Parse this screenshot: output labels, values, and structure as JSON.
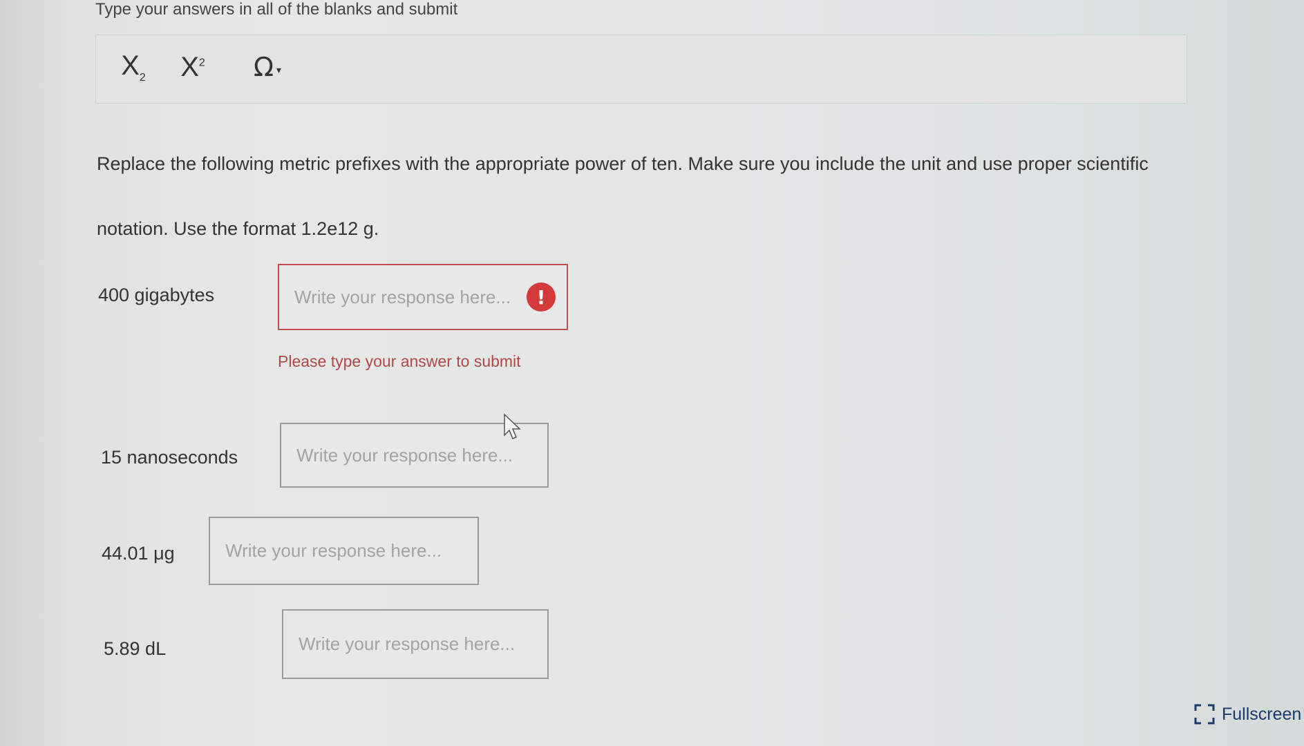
{
  "instruction": "Type your answers in all of the blanks and submit",
  "toolbar": {
    "subscript": "X",
    "subscript_mark": "2",
    "superscript": "X",
    "superscript_mark": "2",
    "special_char": "Ω",
    "special_char_caret": "▾"
  },
  "question": "Replace the following metric prefixes with the appropriate power of ten.  Make sure you include the unit and use proper scientific notation.  Use the format 1.2e12 g.",
  "items": [
    {
      "label": "400 gigabytes",
      "placeholder": "Write your response here...",
      "value": ""
    },
    {
      "label": "15 nanoseconds",
      "placeholder": "Write your response here...",
      "value": ""
    },
    {
      "label": "44.01 μg",
      "placeholder": "Write your response here...",
      "value": ""
    },
    {
      "label": "5.89 dL",
      "placeholder": "Write your response here...",
      "value": ""
    }
  ],
  "error": {
    "icon": "!",
    "message": "Please type your answer to submit"
  },
  "fullscreen": {
    "label": "Fullscreen",
    "icon": "fullscreen-icon"
  },
  "colors": {
    "error": "#d33b3b",
    "error_text": "#b04848",
    "link": "#1a3a6b"
  }
}
